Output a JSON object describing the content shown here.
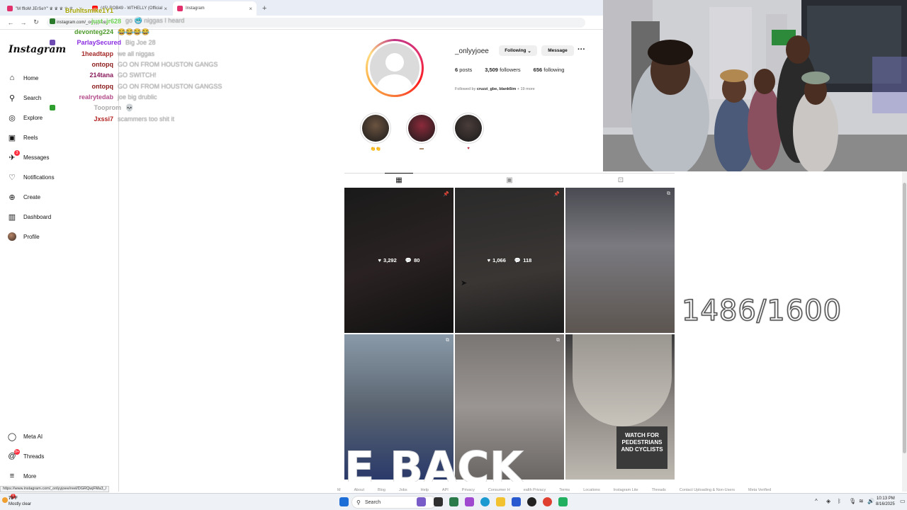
{
  "browser": {
    "tabs": [
      {
        "title": "\"M ffloM JErSeY\" ♛ ♛ ♛ ♛ ♛",
        "active": false,
        "icon_color": "#e1306c"
      },
      {
        "title": "(45) ROB49 - WTHELLY (Official",
        "active": false,
        "icon_color": "#ff0000"
      },
      {
        "title": "Instagram",
        "active": true,
        "icon_color": "#e1306c"
      }
    ],
    "new_tab": "+",
    "url": "instagram.com/_onlyyjoee/",
    "status_url": "https://www.instagram.com/_onlyyjoee/reel/DGRQwjFMa3_/"
  },
  "sidebar": {
    "logo": "Instagram",
    "items": [
      {
        "label": "Home",
        "icon": "home-icon",
        "glyph": "⌂"
      },
      {
        "label": "Search",
        "icon": "search-icon",
        "glyph": "⚲"
      },
      {
        "label": "Explore",
        "icon": "explore-icon",
        "glyph": "◎"
      },
      {
        "label": "Reels",
        "icon": "reels-icon",
        "glyph": "▣"
      },
      {
        "label": "Messages",
        "icon": "messages-icon",
        "glyph": "✈",
        "badge": "3"
      },
      {
        "label": "Notifications",
        "icon": "heart-icon",
        "glyph": "♡"
      },
      {
        "label": "Create",
        "icon": "plus-icon",
        "glyph": "⊕"
      },
      {
        "label": "Dashboard",
        "icon": "dashboard-icon",
        "glyph": "▥"
      },
      {
        "label": "Profile",
        "icon": "avatar",
        "glyph": ""
      }
    ],
    "bottom_items": [
      {
        "label": "Meta AI",
        "icon": "meta-ai-icon",
        "glyph": "◯"
      },
      {
        "label": "Threads",
        "icon": "threads-icon",
        "glyph": "@",
        "badge": "9+"
      },
      {
        "label": "More",
        "icon": "menu-icon",
        "glyph": "≡"
      }
    ]
  },
  "chat": [
    {
      "user": "Bruhitsmike1Y1",
      "color": "#a1a100",
      "msg": "",
      "badge": ""
    },
    {
      "user": "just_jr628",
      "color": "#6ad150",
      "msg": "go 🥶 niggas I heard",
      "badge": "#2b7a2b"
    },
    {
      "user": "devonteg224",
      "color": "#4c9a2a",
      "msg": "😂😂😂😂",
      "badge": ""
    },
    {
      "user": "ParlaySecured",
      "color": "#8a2be2",
      "msg": "Big Joe 28",
      "badge": "#6e4ab3"
    },
    {
      "user": "1headtapp",
      "color": "#a52a2a",
      "msg": "we all niggas",
      "badge": ""
    },
    {
      "user": "ontopq",
      "color": "#8b1a1a",
      "msg": "GO ON FROM HOUSTON GANGS",
      "badge": ""
    },
    {
      "user": "214tana",
      "color": "#8a1c5c",
      "msg": "GO SWITCH!",
      "badge": ""
    },
    {
      "user": "ontopq",
      "color": "#8b1a1a",
      "msg": "GO ON FROM HOUSTON GANGSS",
      "badge": ""
    },
    {
      "user": "realrytedab",
      "color": "#b34d8c",
      "msg": "joe big drublic",
      "badge": ""
    },
    {
      "user": "Tooprom",
      "color": "#aaaaaa",
      "msg": "💀",
      "badge": "#2e9e2e"
    },
    {
      "user": "Jxssi7",
      "color": "#b22222",
      "msg": "scammers too shit it",
      "badge": ""
    }
  ],
  "profile": {
    "username": "_onlyyjoee",
    "following_btn": "Following",
    "message_btn": "Message",
    "posts_count": "6",
    "posts_label": "posts",
    "followers_count": "3,509",
    "followers_label": "followers",
    "following_count": "656",
    "following_label": "following",
    "followed_by_prefix": "Followed by",
    "followed_by_names": "cruzzi_gbe, blank6im",
    "followed_by_suffix": "+ 19 more",
    "highlights": [
      {
        "label": "👏👏",
        "color": "#6b5340"
      },
      {
        "label": "▬",
        "color": "#8b2a3a"
      },
      {
        "label": "♥",
        "color": "#4a3d3a"
      }
    ]
  },
  "posts": [
    {
      "likes": "3,292",
      "comments": "80",
      "bg": "linear-gradient(160deg,#1a1a1a,#2a2222 50%,#0f0f0f)",
      "show_stats": true,
      "pin": "📌"
    },
    {
      "likes": "1,066",
      "comments": "118",
      "bg": "linear-gradient(170deg,#2a2a2a,#3a3634 60%,#1a1a1a)",
      "show_stats": true,
      "pin": "📌"
    },
    {
      "likes": "",
      "comments": "",
      "bg": "linear-gradient(180deg,#4a4a52,#7a7a80 40%,#5c5550)",
      "show_stats": false,
      "pin": "⧉"
    },
    {
      "likes": "",
      "comments": "",
      "bg": "linear-gradient(180deg,#8a9aa8,#5a6470 50%,#2a3a6a)",
      "show_stats": false,
      "pin": "⧉"
    },
    {
      "likes": "",
      "comments": "",
      "bg": "linear-gradient(180deg,#7a7674,#9a9592 50%,#6a6664)",
      "show_stats": false,
      "pin": "⧉"
    },
    {
      "likes": "",
      "comments": "",
      "bg": "linear-gradient(180deg,#3a3a3a,#8a8480 45%,#bdb8b0)",
      "show_stats": false,
      "pin": "⧉"
    }
  ],
  "sign_text": "WATCH FOR PEDESTRIANS AND CYCLISTS",
  "overlays": {
    "counter": "1486/1600",
    "back_text": "E BACK"
  },
  "footer_links": [
    "M",
    "About",
    "Blog",
    "Jobs",
    "Help",
    "API",
    "Privacy",
    "Consumer H",
    "ealth Privacy",
    "Terms",
    "Locations",
    "Instagram Lite",
    "Threads",
    "Contact Uploading & Non-Users",
    "Meta Verified"
  ],
  "taskbar": {
    "weather_temp": "78°F",
    "weather_desc": "Mostly clear",
    "search_placeholder": "Search",
    "time": "10:13 PM",
    "date": "8/16/2025",
    "weather_badge": "1"
  }
}
